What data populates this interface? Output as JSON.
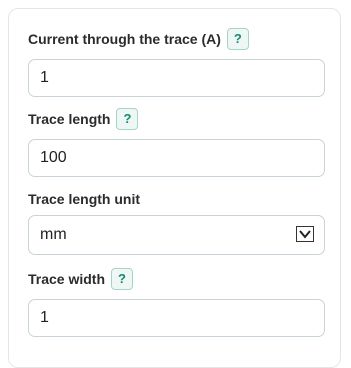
{
  "form": {
    "current": {
      "label": "Current through the trace (A)",
      "help": "?",
      "value": "1"
    },
    "trace_length": {
      "label": "Trace length",
      "help": "?",
      "value": "100"
    },
    "trace_length_unit": {
      "label": "Trace length unit",
      "value": "mm"
    },
    "trace_width": {
      "label": "Trace width",
      "help": "?",
      "value": "1"
    }
  }
}
